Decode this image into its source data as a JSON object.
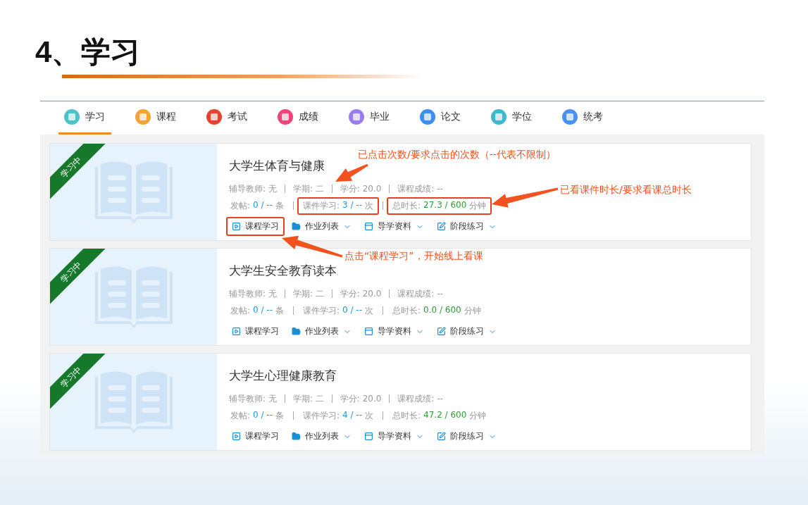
{
  "slide_title": "4、学习",
  "tabs": [
    {
      "label": "学习",
      "selected": true,
      "color": "#4cc3c9"
    },
    {
      "label": "课程",
      "selected": false,
      "color": "#f7a235"
    },
    {
      "label": "考试",
      "selected": false,
      "color": "#e8412f"
    },
    {
      "label": "成绩",
      "selected": false,
      "color": "#f0437a"
    },
    {
      "label": "毕业",
      "selected": false,
      "color": "#9b7cf0"
    },
    {
      "label": "论文",
      "selected": false,
      "color": "#3b8ff0"
    },
    {
      "label": "学位",
      "selected": false,
      "color": "#3cb8d0"
    },
    {
      "label": "统考",
      "selected": false,
      "color": "#4a8ff5"
    }
  ],
  "courses": [
    {
      "ribbon": "学习中",
      "title": "大学生体育与健康",
      "meta": [
        {
          "label": "辅导教师:",
          "value": "无"
        },
        {
          "label": "学期:",
          "value": "二"
        },
        {
          "label": "学分:",
          "value": "20.0"
        },
        {
          "label": "课程成绩:",
          "value": "--"
        }
      ],
      "stats": [
        {
          "label": "发帖:",
          "value": "0 / --",
          "unit": "条",
          "kind": "count",
          "highlighted": false
        },
        {
          "label": "课件学习:",
          "value": "3 / --",
          "unit": "次",
          "kind": "count",
          "highlighted": true
        },
        {
          "label": "总时长:",
          "value": "27.3 / 600",
          "unit": "分钟",
          "kind": "duration",
          "highlighted": true
        }
      ],
      "actions": [
        {
          "label": "课程学习",
          "kind": "play",
          "dropdown": false,
          "highlighted": true
        },
        {
          "label": "作业列表",
          "kind": "folder",
          "dropdown": true,
          "highlighted": false
        },
        {
          "label": "导学资料",
          "kind": "list",
          "dropdown": true,
          "highlighted": false
        },
        {
          "label": "阶段练习",
          "kind": "edit",
          "dropdown": true,
          "highlighted": false
        }
      ]
    },
    {
      "ribbon": "学习中",
      "title": "大学生安全教育读本",
      "meta": [
        {
          "label": "辅导教师:",
          "value": "无"
        },
        {
          "label": "学期:",
          "value": "二"
        },
        {
          "label": "学分:",
          "value": "20.0"
        },
        {
          "label": "课程成绩:",
          "value": "--"
        }
      ],
      "stats": [
        {
          "label": "发帖:",
          "value": "0 / --",
          "unit": "条",
          "kind": "count",
          "highlighted": false
        },
        {
          "label": "课件学习:",
          "value": "0 / --",
          "unit": "次",
          "kind": "count",
          "highlighted": false
        },
        {
          "label": "总时长:",
          "value": "0.0 / 600",
          "unit": "分钟",
          "kind": "duration",
          "highlighted": false
        }
      ],
      "actions": [
        {
          "label": "课程学习",
          "kind": "play",
          "dropdown": false,
          "highlighted": false
        },
        {
          "label": "作业列表",
          "kind": "folder",
          "dropdown": true,
          "highlighted": false
        },
        {
          "label": "导学资料",
          "kind": "list",
          "dropdown": true,
          "highlighted": false
        },
        {
          "label": "阶段练习",
          "kind": "edit",
          "dropdown": true,
          "highlighted": false
        }
      ]
    },
    {
      "ribbon": "学习中",
      "title": "大学生心理健康教育",
      "meta": [
        {
          "label": "辅导教师:",
          "value": "无"
        },
        {
          "label": "学期:",
          "value": "二"
        },
        {
          "label": "学分:",
          "value": "20.0"
        },
        {
          "label": "课程成绩:",
          "value": "--"
        }
      ],
      "stats": [
        {
          "label": "发帖:",
          "value": "0 / --",
          "unit": "条",
          "kind": "count",
          "highlighted": false
        },
        {
          "label": "课件学习:",
          "value": "4 / --",
          "unit": "次",
          "kind": "count",
          "highlighted": false
        },
        {
          "label": "总时长:",
          "value": "47.2 / 600",
          "unit": "分钟",
          "kind": "duration",
          "highlighted": false
        }
      ],
      "actions": [
        {
          "label": "课程学习",
          "kind": "play",
          "dropdown": false,
          "highlighted": false
        },
        {
          "label": "作业列表",
          "kind": "folder",
          "dropdown": true,
          "highlighted": false
        },
        {
          "label": "导学资料",
          "kind": "list",
          "dropdown": true,
          "highlighted": false
        },
        {
          "label": "阶段练习",
          "kind": "edit",
          "dropdown": true,
          "highlighted": false
        }
      ]
    }
  ],
  "annotations": [
    "已点击次数/要求点击的次数（--代表不限制）",
    "已看课件时长/要求看课总时长",
    "点击“课程学习”，开始线上看课"
  ]
}
